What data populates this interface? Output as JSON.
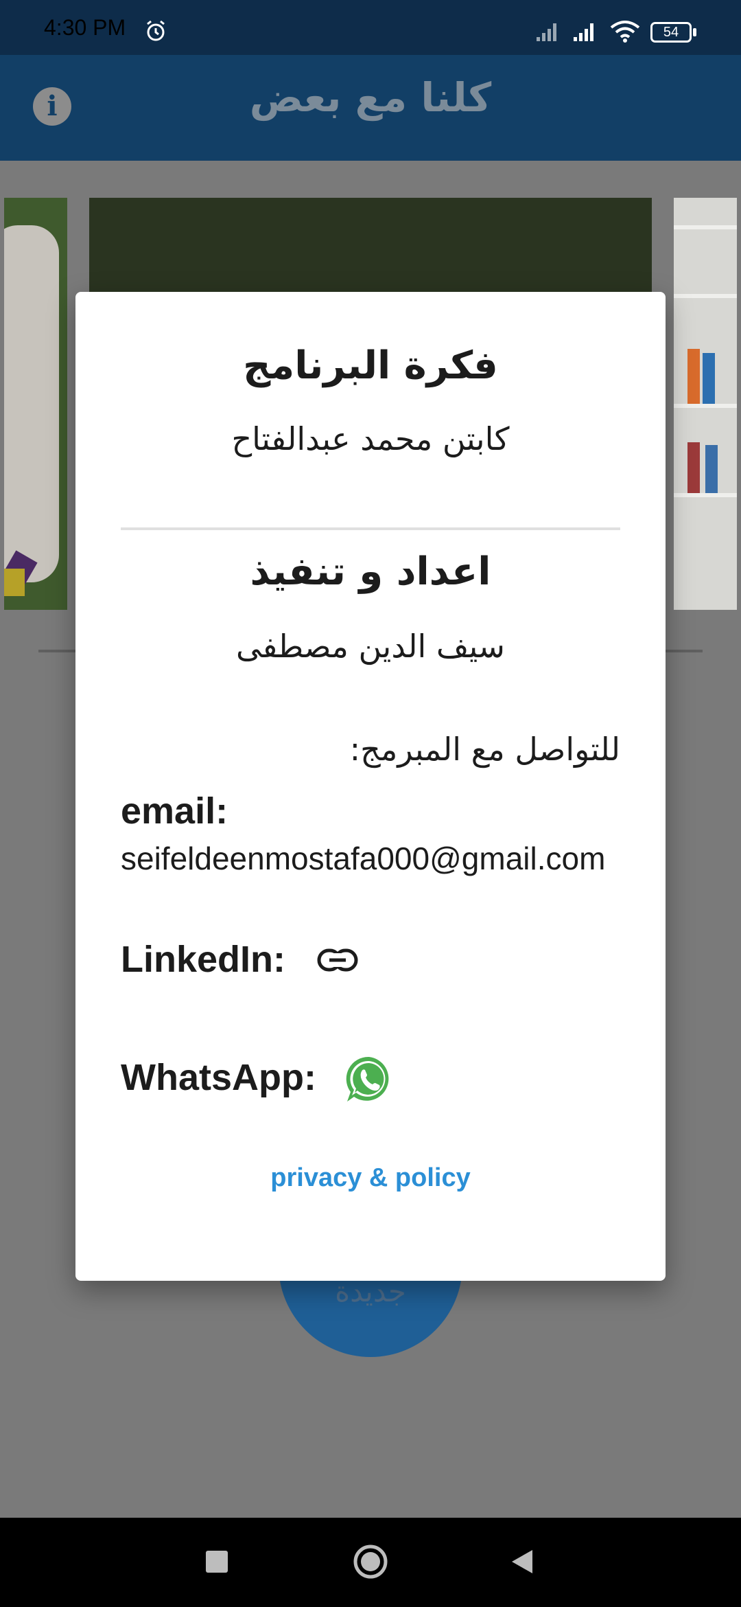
{
  "status_bar": {
    "time": "4:30 PM",
    "battery": "54"
  },
  "app_bar": {
    "title": "كلنا مع بعض"
  },
  "background": {
    "new_button_label": "جديدة"
  },
  "dialog": {
    "idea_title": "فكرة البرنامج",
    "idea_name": "كابتن محمد عبدالفتاح",
    "implementation_title": "اعداد و تنفيذ",
    "implementation_name": "سيف الدين مصطفى",
    "contact_heading": "للتواصل مع المبرمج:",
    "email_label": "email:",
    "email_value": "seifeldeenmostafa000@gmail.com",
    "linkedin_label": "LinkedIn:",
    "whatsapp_label": "WhatsApp:",
    "privacy_link": "privacy & policy"
  },
  "colors": {
    "accent": "#2b8fd6",
    "app_bar": "#123f66",
    "whatsapp": "#4caf50"
  }
}
